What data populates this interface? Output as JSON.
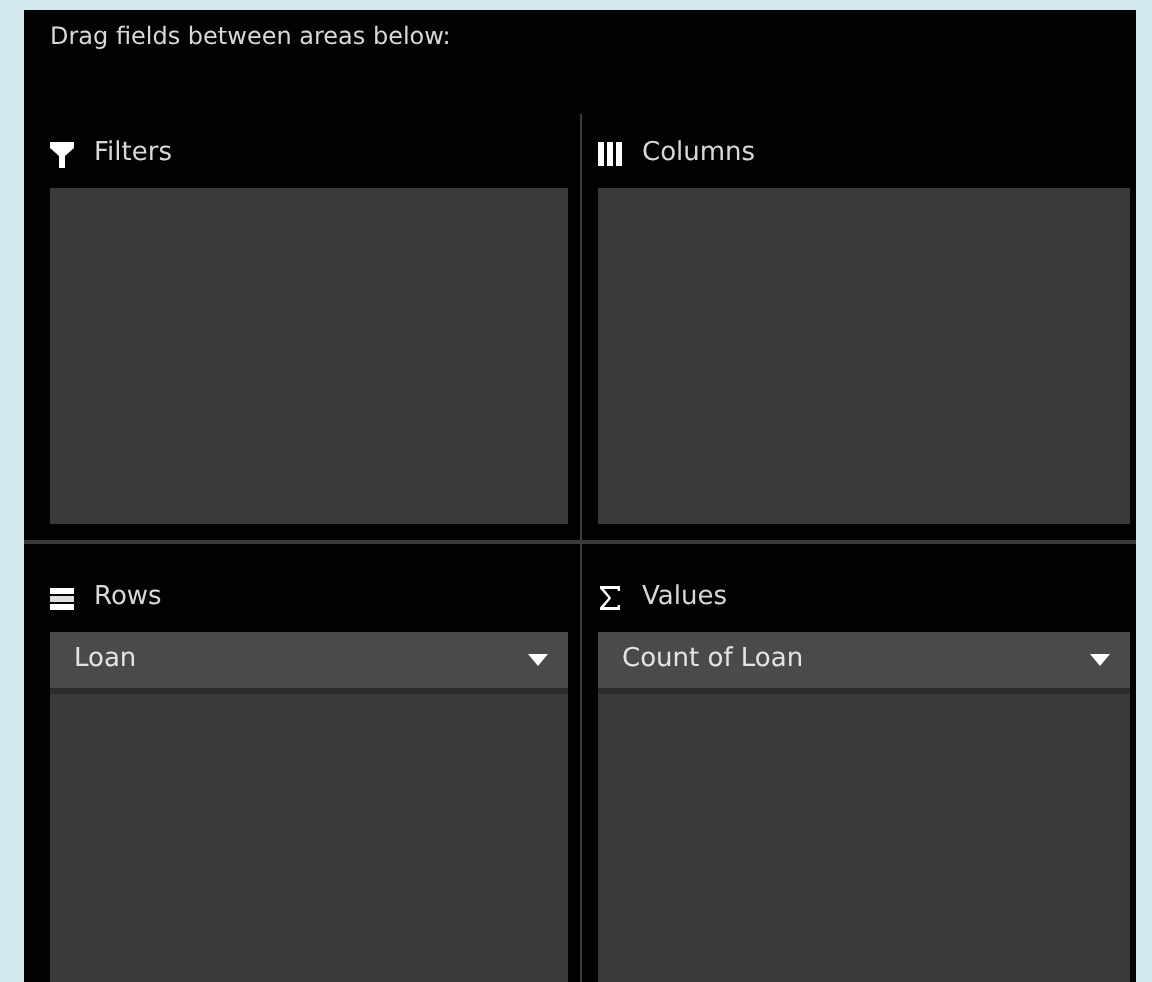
{
  "instruction": "Drag fields between areas below:",
  "areas": [
    {
      "kind": "filters",
      "label": "Filters"
    },
    {
      "kind": "columns",
      "label": "Columns"
    },
    {
      "kind": "rows",
      "label": "Rows",
      "fields": [
        "Loan"
      ]
    },
    {
      "kind": "values",
      "label": "Values",
      "fields": [
        "Count of Loan"
      ]
    }
  ]
}
